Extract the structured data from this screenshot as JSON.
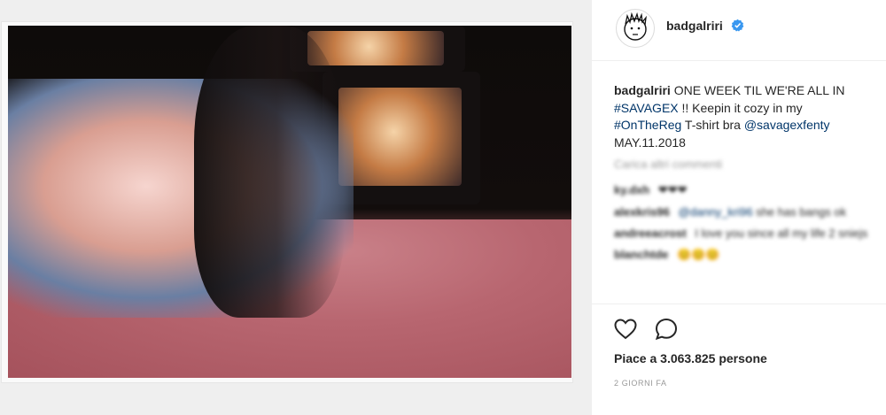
{
  "post": {
    "username": "badgalriri",
    "verified": true,
    "caption_user": "badgalriri",
    "caption_text_1": "ONE WEEK TIL WE'RE ALL IN",
    "caption_hashtag_1": "#SAVAGEX",
    "caption_text_2": "!! Keepin it cozy in my",
    "caption_hashtag_2": "#OnTheReg",
    "caption_text_3": "T-shirt bra",
    "caption_mention": "@savagexfenty",
    "caption_date": "MAY.11.2018"
  },
  "comments": {
    "load_more": "Carica altri commenti",
    "items": [
      {
        "user": "ky.dxh",
        "text": "❤❤❤"
      },
      {
        "user": "alexkris96",
        "tag": "@danny_kri96",
        "text": "she has bangs ok"
      },
      {
        "user": "andreeacrost",
        "text": "I love you since all my life 2 sniejs"
      },
      {
        "user": "blanchtde",
        "text": "😊😊😊"
      }
    ]
  },
  "actions": {
    "like_icon": "heart-outline-icon",
    "comment_icon": "speech-bubble-icon"
  },
  "likes_label": "Piace a 3.063.825 persone",
  "timestamp": "2 GIORNI FA",
  "colors": {
    "link": "#003569",
    "verified_blue": "#3897f0",
    "muted": "#999999",
    "text": "#262626"
  }
}
